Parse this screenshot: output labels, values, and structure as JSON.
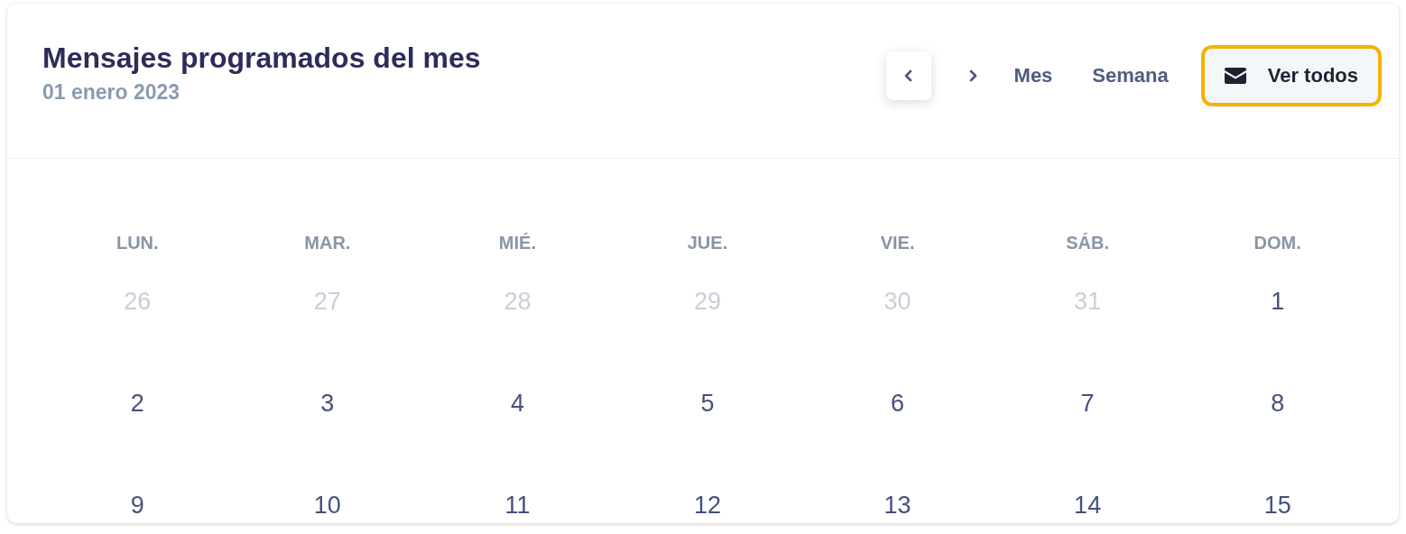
{
  "header": {
    "title": "Mensajes programados del mes",
    "date": "01 enero 2023"
  },
  "nav_buttons": [
    {
      "kind": "prev",
      "highlighted": true
    },
    {
      "kind": "next",
      "highlighted": false
    }
  ],
  "views": [
    {
      "label": "Mes"
    },
    {
      "label": "Semana"
    }
  ],
  "action_button": {
    "label": "Ver todos",
    "focused": true
  },
  "weekdays": [
    "LUN.",
    "MAR.",
    "MIÉ.",
    "JUE.",
    "VIE.",
    "SÁB.",
    "DOM."
  ],
  "weeks": [
    [
      {
        "day": "26",
        "other_month": true
      },
      {
        "day": "27",
        "other_month": true
      },
      {
        "day": "28",
        "other_month": true
      },
      {
        "day": "29",
        "other_month": true
      },
      {
        "day": "30",
        "other_month": true
      },
      {
        "day": "31",
        "other_month": true
      },
      {
        "day": "1",
        "other_month": false
      }
    ],
    [
      {
        "day": "2",
        "other_month": false
      },
      {
        "day": "3",
        "other_month": false
      },
      {
        "day": "4",
        "other_month": false
      },
      {
        "day": "5",
        "other_month": false
      },
      {
        "day": "6",
        "other_month": false
      },
      {
        "day": "7",
        "other_month": false
      },
      {
        "day": "8",
        "other_month": false
      }
    ],
    [
      {
        "day": "9",
        "other_month": false
      },
      {
        "day": "10",
        "other_month": false
      },
      {
        "day": "11",
        "other_month": false
      },
      {
        "day": "12",
        "other_month": false
      },
      {
        "day": "13",
        "other_month": false
      },
      {
        "day": "14",
        "other_month": false
      },
      {
        "day": "15",
        "other_month": false
      }
    ]
  ]
}
